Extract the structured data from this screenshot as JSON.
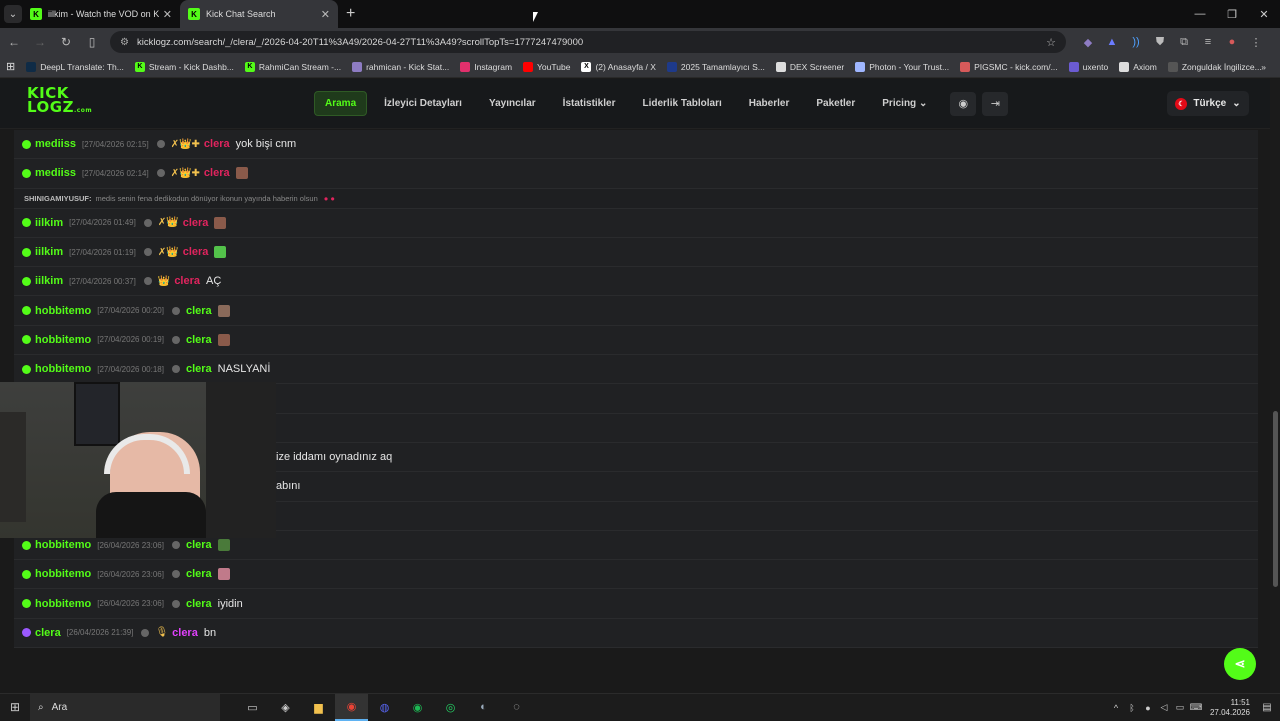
{
  "browser": {
    "tabs": [
      {
        "title": "iilkim - Watch the VOD on Kick",
        "icon": "kick-icon",
        "color": "#53fc18",
        "active": false
      },
      {
        "title": "Kick Chat Search",
        "icon": "kicklogz-icon",
        "color": "#53fc18",
        "active": true
      }
    ],
    "url": "kicklogz.com/search/_/clera/_/2026-04-20T11%3A49/2026-04-27T11%3A49?scrollTopTs=1777247479000",
    "bookmarks": [
      {
        "label": "DeepL Translate: Th...",
        "color": "#0f2b46"
      },
      {
        "label": "Stream - Kick Dashb...",
        "color": "#53fc18"
      },
      {
        "label": "RahmiCan Stream -...",
        "color": "#53fc18"
      },
      {
        "label": "rahmican - Kick Stat...",
        "color": "#8e7cc3"
      },
      {
        "label": "Instagram",
        "color": "#e1306c"
      },
      {
        "label": "YouTube",
        "color": "#ff0000"
      },
      {
        "label": "(2) Anasayfa / X",
        "color": "#ffffff"
      },
      {
        "label": "2025 Tamamlayıcı S...",
        "color": "#1e3a8a"
      },
      {
        "label": "DEX Screener",
        "color": "#dddddd"
      },
      {
        "label": "Photon - Your Trust...",
        "color": "#9fb6ff"
      },
      {
        "label": "PIGSMC - kick.com/...",
        "color": "#d65a5a"
      },
      {
        "label": "uxento",
        "color": "#6b5bd2"
      },
      {
        "label": "Axiom",
        "color": "#dddddd"
      },
      {
        "label": "Zonguldak İngilizce...",
        "color": "#555555"
      }
    ]
  },
  "site": {
    "logo_line1": "KICK",
    "logo_line2": "LOGZ",
    "logo_suffix": ".com",
    "nav": [
      "Arama",
      "İzleyici Detayları",
      "Yayıncılar",
      "İstatistikler",
      "Liderlik Tabloları",
      "Haberler",
      "Paketler",
      "Pricing"
    ],
    "language": "Türkçe"
  },
  "chat": [
    {
      "user": "mediiss",
      "time": "[27/04/2026 02:15]",
      "channel": "clera",
      "chan_color": "#e0245e",
      "msg": "yok bişi cnm",
      "icons": "✗👑✚",
      "emote": ""
    },
    {
      "user": "mediiss",
      "time": "[27/04/2026 02:14]",
      "channel": "clera",
      "chan_color": "#e0245e",
      "msg": "",
      "icons": "✗👑✚",
      "emote": "#8a5a4a",
      "reply_user": "SHINIGAMIYUSUF:",
      "reply_text": "medis senin fena dedikodun dönüyor ikonun yayında haberin olsun"
    },
    {
      "user": "iilkim",
      "time": "[27/04/2026 01:49]",
      "channel": "clera",
      "chan_color": "#e0245e",
      "msg": "",
      "icons": "✗👑",
      "emote": "#8a5a4a"
    },
    {
      "user": "iilkim",
      "time": "[27/04/2026 01:19]",
      "channel": "clera",
      "chan_color": "#e0245e",
      "msg": "",
      "icons": "✗👑",
      "emote": "#53c24a"
    },
    {
      "user": "iilkim",
      "time": "[27/04/2026 00:37]",
      "channel": "clera",
      "chan_color": "#e0245e",
      "msg": "AÇ",
      "icons": "👑",
      "emote": ""
    },
    {
      "user": "hobbitemo",
      "time": "[27/04/2026 00:20]",
      "channel": "clera",
      "chan_color": "#53fc18",
      "msg": "",
      "icons": "",
      "emote": "#8a6a5a"
    },
    {
      "user": "hobbitemo",
      "time": "[27/04/2026 00:19]",
      "channel": "clera",
      "chan_color": "#53fc18",
      "msg": "",
      "icons": "",
      "emote": "#8a5a4a"
    },
    {
      "user": "hobbitemo",
      "time": "[27/04/2026 00:18]",
      "channel": "clera",
      "chan_color": "#53fc18",
      "msg": "NASLYANİ",
      "icons": "",
      "emote": ""
    },
    {
      "user": "",
      "time": "",
      "channel": "",
      "chan_color": "#53fc18",
      "msg": "",
      "icons": "",
      "emote": ""
    },
    {
      "user": "",
      "time": "",
      "channel": "",
      "chan_color": "#53fc18",
      "msg": "",
      "icons": "",
      "emote": ""
    },
    {
      "user": "",
      "time": "",
      "channel": "",
      "chan_color": "#53fc18",
      "msg": "ize iddamı oynadınız aq",
      "icons": "",
      "emote": ""
    },
    {
      "user": "",
      "time": "",
      "channel": "",
      "chan_color": "#53fc18",
      "msg": "abını",
      "icons": "",
      "emote": ""
    },
    {
      "user": "hobbitemo",
      "time": "[26/04/2026 23:07]",
      "channel": "clera",
      "chan_color": "#53fc18",
      "msg": "",
      "icons": "",
      "emote": "#8a5a4a"
    },
    {
      "user": "hobbitemo",
      "time": "[26/04/2026 23:06]",
      "channel": "clera",
      "chan_color": "#53fc18",
      "msg": "",
      "icons": "",
      "emote": "#4a7a3a"
    },
    {
      "user": "hobbitemo",
      "time": "[26/04/2026 23:06]",
      "channel": "clera",
      "chan_color": "#53fc18",
      "msg": "",
      "icons": "",
      "emote": "#c07a8a"
    },
    {
      "user": "hobbitemo",
      "time": "[26/04/2026 23:06]",
      "channel": "clera",
      "chan_color": "#53fc18",
      "msg": "iyidin",
      "icons": "",
      "emote": ""
    },
    {
      "user": "clera",
      "time": "[26/04/2026 21:39]",
      "channel": "clera",
      "chan_color": "#e040fb",
      "msg": "bn",
      "icons": "🎙",
      "emote": ""
    }
  ],
  "taskbar": {
    "search_placeholder": "Ara",
    "time": "11:51",
    "date": "27.04.2026"
  }
}
